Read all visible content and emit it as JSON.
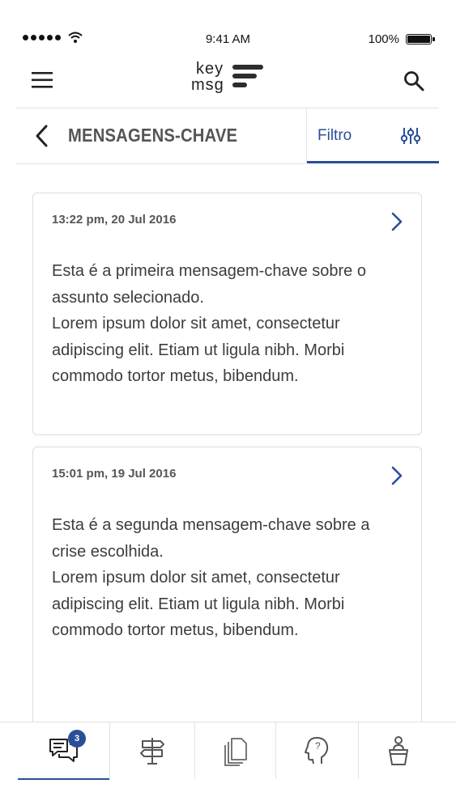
{
  "status_bar": {
    "time": "9:41 AM",
    "battery": "100%",
    "icons": [
      "signal-dots-icon",
      "wifi-icon",
      "battery-icon"
    ]
  },
  "header": {
    "logo_line1": "key",
    "logo_line2": "msg",
    "icons": [
      "hamburger-menu-icon",
      "search-icon"
    ]
  },
  "title_bar": {
    "title": "MENSAGENS-CHAVE",
    "filter_label": "Filtro",
    "icons": [
      "back-chevron-icon",
      "sliders-filter-icon"
    ]
  },
  "messages": [
    {
      "date": "13:22 pm, 20 Jul 2016",
      "line1": "Esta é a primeira mensagem-chave sobre o assunto selecionado.",
      "line2": "Lorem ipsum dolor sit amet, consectetur adipiscing elit. Etiam ut ligula nibh. Morbi commodo tortor metus, bibendum."
    },
    {
      "date": "15:01 pm, 19 Jul 2016",
      "line1": "Esta é a segunda mensagem-chave sobre a crise escolhida.",
      "line2": "Lorem ipsum dolor sit amet, consectetur adipiscing elit. Etiam ut ligula nibh. Morbi commodo tortor metus, bibendum."
    }
  ],
  "bottom_nav": {
    "badge_count": "3",
    "items": [
      "chat-bubbles-icon",
      "signpost-icon",
      "documents-icon",
      "head-question-icon",
      "person-podium-icon"
    ]
  },
  "colors": {
    "accent": "#2a4f98",
    "text": "#3d3d3d",
    "border": "#dcdcdc"
  }
}
